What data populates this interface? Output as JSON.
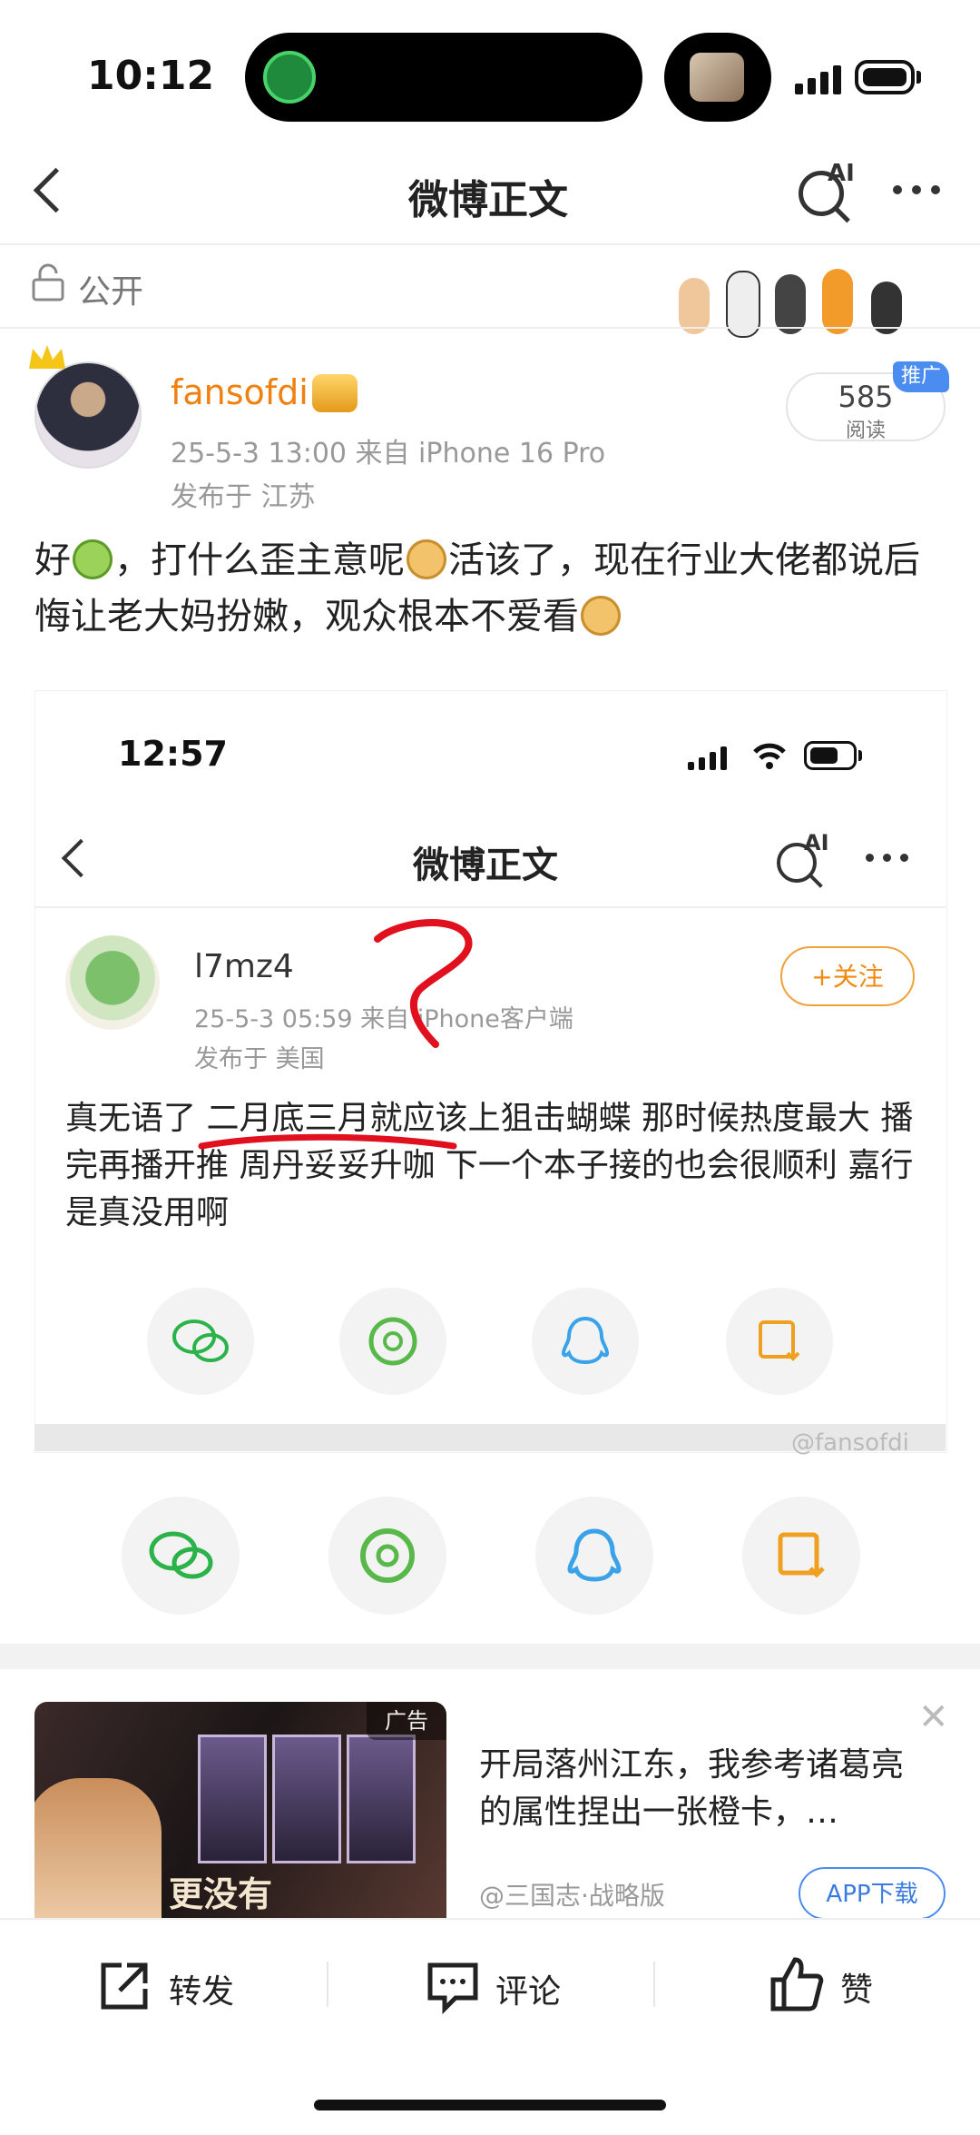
{
  "status_bar": {
    "time": "10:12"
  },
  "nav": {
    "title": "微博正文",
    "ai_label": "AI"
  },
  "visibility": {
    "label": "公开"
  },
  "post": {
    "username": "fansofdi",
    "time_device": "25-5-3 13:00  来自 iPhone 16 Pro",
    "location": "发布于 江苏",
    "views_count": "585",
    "views_label": "阅读",
    "promo_label": "推广",
    "text_parts": [
      "好",
      "，打什么歪主意呢",
      "活该了，现在行业大佬都说后悔让老大妈扮嫩，观众根本不爱看"
    ]
  },
  "embedded": {
    "status_time": "12:57",
    "nav_title": "微博正文",
    "ai_label": "AI",
    "username": "l7mz4",
    "time_device": "25-5-3 05:59  来自 iPhone客户端",
    "location": "发布于 美国",
    "follow_label": "+关注",
    "text": "真无语了 二月底三月就应该上狙击蝴蝶 那时候热度最大 播完再播开推 周丹妥妥升咖 下一个本子接的也会很顺利 嘉行是真没用啊",
    "watermark": "@fansofdi"
  },
  "share": {
    "items": [
      {
        "icon": "wechat-icon",
        "color": "#2bb34a"
      },
      {
        "icon": "moments-icon",
        "color": "#58b94a"
      },
      {
        "icon": "qq-icon",
        "color": "#3aa2e8"
      },
      {
        "icon": "save-image-icon",
        "color": "#f0a020"
      }
    ]
  },
  "ad": {
    "tag": "广告",
    "image_caption": "更没有",
    "title": "开局落州江东，我参考诸葛亮的属性捏出一张橙卡，…",
    "source": "@三国志·战略版",
    "button": "APP下载"
  },
  "toolbar": {
    "repost": "转发",
    "comment": "评论",
    "like": "赞"
  },
  "colors": {
    "accent": "#f08010",
    "link": "#3a7be0",
    "annotation": "#e0101e"
  }
}
